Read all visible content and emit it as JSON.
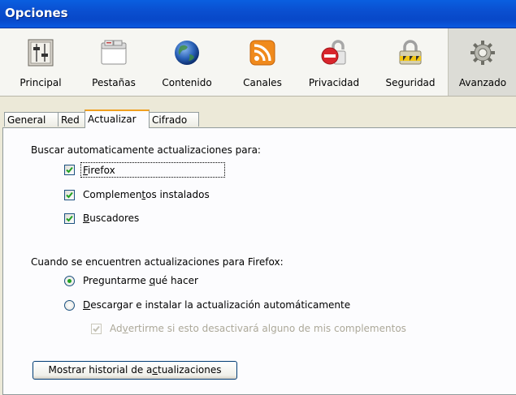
{
  "window": {
    "title": "Opciones"
  },
  "toolbar": {
    "items": [
      {
        "label": "Principal",
        "icon": "switches-icon"
      },
      {
        "label": "Pestañas",
        "icon": "tabs-window-icon"
      },
      {
        "label": "Contenido",
        "icon": "globe-icon"
      },
      {
        "label": "Canales",
        "icon": "rss-feed-icon"
      },
      {
        "label": "Privacidad",
        "icon": "no-entry-icon"
      },
      {
        "label": "Seguridad",
        "icon": "padlock-icon"
      },
      {
        "label": "Avanzado",
        "icon": "gear-icon"
      }
    ],
    "selected": "Avanzado"
  },
  "tabs": {
    "items": [
      "General",
      "Red",
      "Actualizar",
      "Cifrado"
    ],
    "active": "Actualizar"
  },
  "update": {
    "search_heading": "Buscar automaticamente actualizaciones para:",
    "check_firefox": {
      "pre": "",
      "key": "F",
      "post": "irefox",
      "checked": true
    },
    "check_addons": {
      "pre": "Complemen",
      "key": "t",
      "post": "os instalados",
      "checked": true
    },
    "check_search": {
      "pre": "",
      "key": "B",
      "post": "uscadores",
      "checked": true
    },
    "found_heading": "Cuando se encuentren actualizaciones para Firefox:",
    "radio_ask": {
      "pre": "Preguntarme ",
      "key": "q",
      "post": "ué hacer",
      "selected": true
    },
    "radio_auto": {
      "pre": "",
      "key": "D",
      "post": "escargar e instalar la actualización automáticamente",
      "selected": false
    },
    "warn_addons": {
      "pre": "Ad",
      "key": "v",
      "post": "ertirme si esto desactivará alguno de mis complementos",
      "checked": true,
      "disabled": true
    },
    "history_button": {
      "pre": "Mostrar historial de a",
      "key": "c",
      "post": "tualizaciones"
    }
  }
}
